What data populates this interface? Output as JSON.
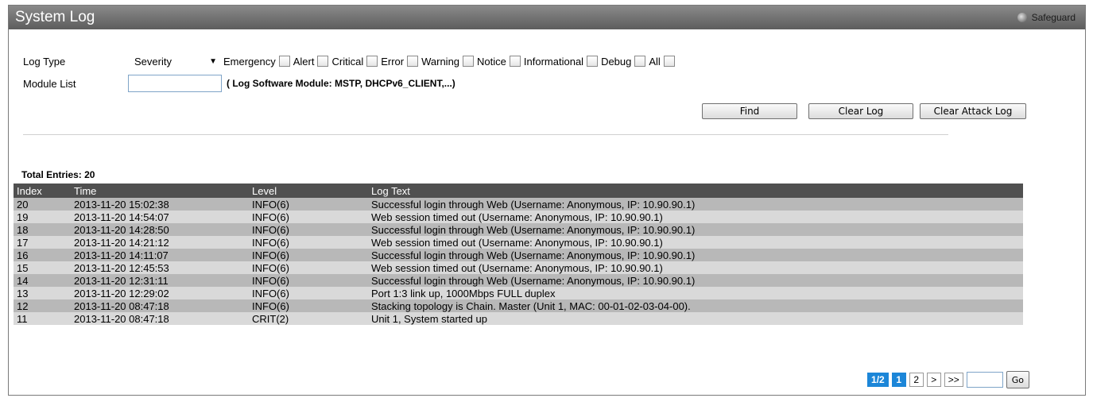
{
  "header": {
    "title": "System Log",
    "safeguard": "Safeguard"
  },
  "filters": {
    "log_type_label": "Log Type",
    "log_type_value": "Severity",
    "severity_options": [
      "Emergency",
      "Alert",
      "Critical",
      "Error",
      "Warning",
      "Notice",
      "Informational",
      "Debug",
      "All"
    ],
    "module_list_label": "Module List",
    "module_list_value": "",
    "module_hint": "( Log Software Module: MSTP, DHCPv6_CLIENT,...)"
  },
  "buttons": {
    "find": "Find",
    "clear_log": "Clear Log",
    "clear_attack_log": "Clear Attack Log"
  },
  "table": {
    "total_entries": "Total Entries: 20",
    "columns": [
      "Index",
      "Time",
      "Level",
      "Log Text"
    ],
    "rows": [
      [
        "20",
        "2013-11-20 15:02:38",
        "INFO(6)",
        "Successful login through Web (Username: Anonymous, IP: 10.90.90.1)"
      ],
      [
        "19",
        "2013-11-20 14:54:07",
        "INFO(6)",
        "Web session timed out (Username: Anonymous, IP: 10.90.90.1)"
      ],
      [
        "18",
        "2013-11-20 14:28:50",
        "INFO(6)",
        "Successful login through Web (Username: Anonymous, IP: 10.90.90.1)"
      ],
      [
        "17",
        "2013-11-20 14:21:12",
        "INFO(6)",
        "Web session timed out (Username: Anonymous, IP: 10.90.90.1)"
      ],
      [
        "16",
        "2013-11-20 14:11:07",
        "INFO(6)",
        "Successful login through Web (Username: Anonymous, IP: 10.90.90.1)"
      ],
      [
        "15",
        "2013-11-20 12:45:53",
        "INFO(6)",
        "Web session timed out (Username: Anonymous, IP: 10.90.90.1)"
      ],
      [
        "14",
        "2013-11-20 12:31:11",
        "INFO(6)",
        "Successful login through Web (Username: Anonymous, IP: 10.90.90.1)"
      ],
      [
        "13",
        "2013-11-20 12:29:02",
        "INFO(6)",
        "Port 1:3 link up, 1000Mbps FULL duplex"
      ],
      [
        "12",
        "2013-11-20 08:47:18",
        "INFO(6)",
        "Stacking topology is Chain. Master (Unit 1, MAC: 00-01-02-03-04-00)."
      ],
      [
        "11",
        "2013-11-20 08:47:18",
        "CRIT(2)",
        "Unit 1, System started up"
      ]
    ]
  },
  "pagination": {
    "page_indicator": "1/2",
    "pages": [
      "1",
      "2"
    ],
    "next": ">",
    "last": ">>",
    "go": "Go"
  }
}
